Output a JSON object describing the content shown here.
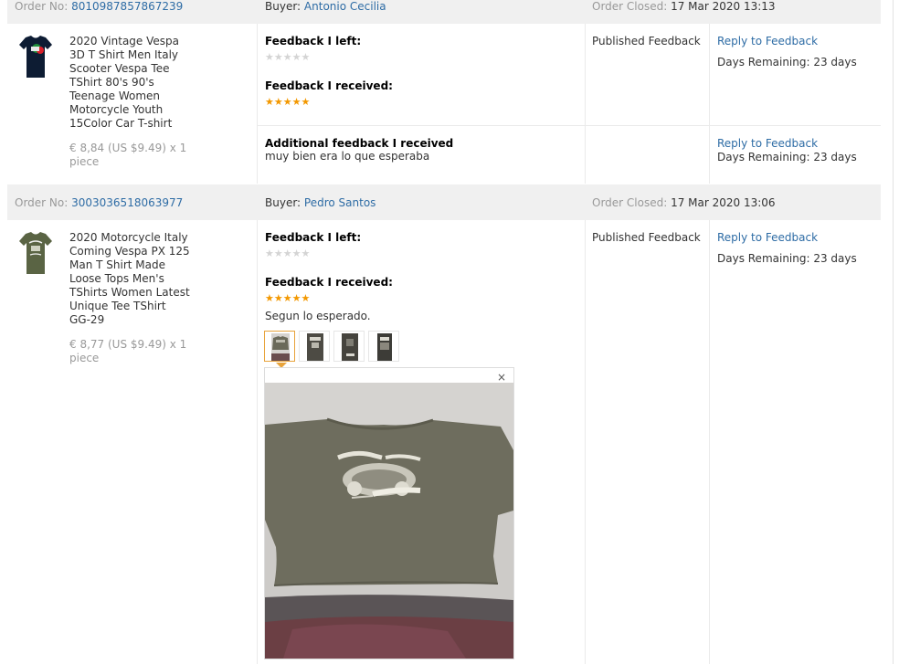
{
  "labels": {
    "order_no": "Order No:",
    "buyer": "Buyer:",
    "order_closed": "Order Closed:",
    "feedback_left": "Feedback I left:",
    "feedback_received": "Feedback I received:",
    "additional_feedback": "Additional feedback I received",
    "published": "Published Feedback",
    "reply": "Reply to Feedback",
    "close_icon": "×"
  },
  "orders": [
    {
      "order_no": "8010987857867239",
      "buyer": "Antonio Cecilia",
      "closed": "17 Mar 2020 13:13",
      "product_title": "2020 Vintage Vespa 3D T Shirt Men Italy Scooter Vespa Tee TShirt 80's 90's Teenage Women Motorcycle Youth 15Color Car T-shirt",
      "price": "€ 8,84 (US $9.49) x 1 piece",
      "shirt_color": "#0d1c33",
      "stars_left": "★★★★★",
      "stars_received": "★★★★★",
      "days_remaining": "Days Remaining: 23 days",
      "additional_comment": "muy bien era lo que esperaba",
      "additional_days_remaining": "Days Remaining: 23 days"
    },
    {
      "order_no": "3003036518063977",
      "buyer": "Pedro Santos",
      "closed": "17 Mar 2020 13:06",
      "product_title": "2020 Motorcycle Italy Coming Vespa PX 125 Man T Shirt Made Loose Tops Men's TShirts Women Latest Unique Tee TShirt GG-29",
      "price": "€ 8,77 (US $9.49) x 1 piece",
      "shirt_color": "#5a6444",
      "stars_left": "★★★★★",
      "stars_received": "★★★★★",
      "comment": "Segun lo esperado.",
      "days_remaining": "Days Remaining: 23 days"
    }
  ],
  "colors": {
    "link": "#2e6ca5",
    "star_gold": "#f39800",
    "star_grey": "#d4d4d4",
    "header_bg": "#f0f0f0"
  }
}
